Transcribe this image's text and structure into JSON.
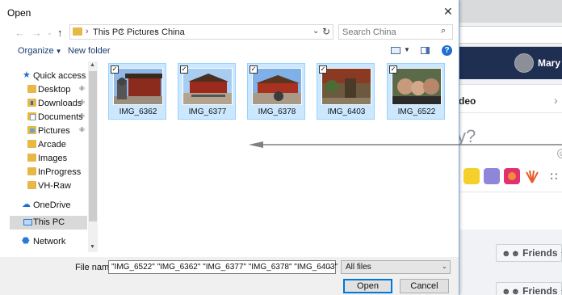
{
  "dialog": {
    "title": "Open",
    "breadcrumbs": [
      "This PC",
      "Pictures",
      "China"
    ],
    "search_placeholder": "Search China",
    "toolbar": {
      "organize": "Organize",
      "new_folder": "New folder"
    },
    "nav_items": [
      {
        "label": "Quick access",
        "icon": "star-icon",
        "pinned": false
      },
      {
        "label": "Desktop",
        "icon": "folder-icon",
        "pinned": true
      },
      {
        "label": "Downloads",
        "icon": "downloads-folder-icon",
        "pinned": true
      },
      {
        "label": "Documents",
        "icon": "documents-folder-icon",
        "pinned": true
      },
      {
        "label": "Pictures",
        "icon": "pictures-folder-icon",
        "pinned": true
      },
      {
        "label": "Arcade",
        "icon": "folder-icon",
        "pinned": false
      },
      {
        "label": "Images",
        "icon": "folder-icon",
        "pinned": false
      },
      {
        "label": "InProgress",
        "icon": "folder-icon",
        "pinned": false
      },
      {
        "label": "VH-Raw",
        "icon": "folder-icon",
        "pinned": false
      },
      {
        "label": "OneDrive",
        "icon": "cloud-icon",
        "pinned": false
      },
      {
        "label": "This PC",
        "icon": "computer-icon",
        "pinned": false,
        "selected": true
      },
      {
        "label": "Network",
        "icon": "network-icon",
        "pinned": false
      }
    ],
    "files": [
      {
        "name": "IMG_6362",
        "selected": true
      },
      {
        "name": "IMG_6377",
        "selected": true
      },
      {
        "name": "IMG_6378",
        "selected": true
      },
      {
        "name": "IMG_6403",
        "selected": true
      },
      {
        "name": "IMG_6522",
        "selected": true
      }
    ],
    "file_name_label": "File name:",
    "file_name_value": "\"IMG_6522\" \"IMG_6362\" \"IMG_6377\" \"IMG_6378\" \"IMG_6403\"",
    "file_type": "All files",
    "open_label": "Open",
    "cancel_label": "Cancel"
  },
  "background": {
    "user_name": "Mary",
    "card_title": "deo",
    "prompt_glyph": "y?",
    "friends_label_1": "Friends",
    "friends_label_2": "Friends"
  },
  "colors": {
    "accent": "#0078d7",
    "selection": "#cce8ff",
    "folder": "#e8b847",
    "navbar": "#1f2f52"
  }
}
